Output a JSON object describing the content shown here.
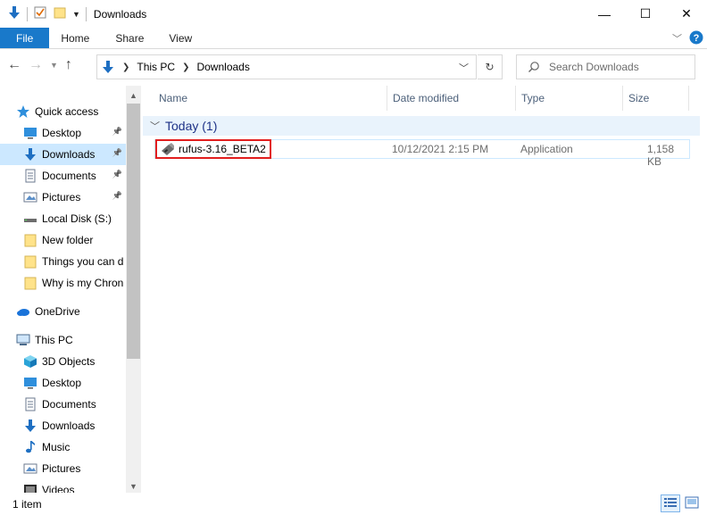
{
  "window": {
    "title": "Downloads",
    "controls": [
      "—",
      "☐",
      "✕"
    ]
  },
  "ribbon": {
    "tabs": [
      "File",
      "Home",
      "Share",
      "View"
    ]
  },
  "address": {
    "crumbs": [
      "This PC",
      "Downloads"
    ],
    "search_placeholder": "Search Downloads"
  },
  "nav": {
    "items": [
      {
        "label": "Quick access",
        "icon": "star-icon"
      },
      {
        "label": "Desktop",
        "icon": "desktop-icon",
        "pinned": true
      },
      {
        "label": "Downloads",
        "icon": "download-icon",
        "pinned": true,
        "selected": true
      },
      {
        "label": "Documents",
        "icon": "document-icon",
        "pinned": true
      },
      {
        "label": "Pictures",
        "icon": "pictures-icon",
        "pinned": true
      },
      {
        "label": "Local Disk (S:)",
        "icon": "drive-icon"
      },
      {
        "label": "New folder",
        "icon": "folder-icon"
      },
      {
        "label": "Things you can d",
        "icon": "folder-icon"
      },
      {
        "label": "Why is my Chron",
        "icon": "folder-icon"
      },
      {
        "label": "OneDrive",
        "icon": "cloud-icon"
      },
      {
        "label": "This PC",
        "icon": "computer-icon"
      },
      {
        "label": "3D Objects",
        "icon": "cube-icon"
      },
      {
        "label": "Desktop",
        "icon": "desktop-icon"
      },
      {
        "label": "Documents",
        "icon": "document-icon"
      },
      {
        "label": "Downloads",
        "icon": "download-icon"
      },
      {
        "label": "Music",
        "icon": "music-icon"
      },
      {
        "label": "Pictures",
        "icon": "pictures-icon"
      },
      {
        "label": "Videos",
        "icon": "video-icon"
      }
    ]
  },
  "columns": [
    "Name",
    "Date modified",
    "Type",
    "Size"
  ],
  "group": {
    "label": "Today (1)"
  },
  "files": [
    {
      "name": "rufus-3.16_BETA2",
      "date": "10/12/2021 2:15 PM",
      "type": "Application",
      "size": "1,158 KB"
    }
  ],
  "status": {
    "count": "1 item"
  },
  "colors": {
    "accent": "#1979ca",
    "selection": "#cce8ff",
    "highlight_box": "#e21e1e",
    "group_text": "#1e3287"
  }
}
